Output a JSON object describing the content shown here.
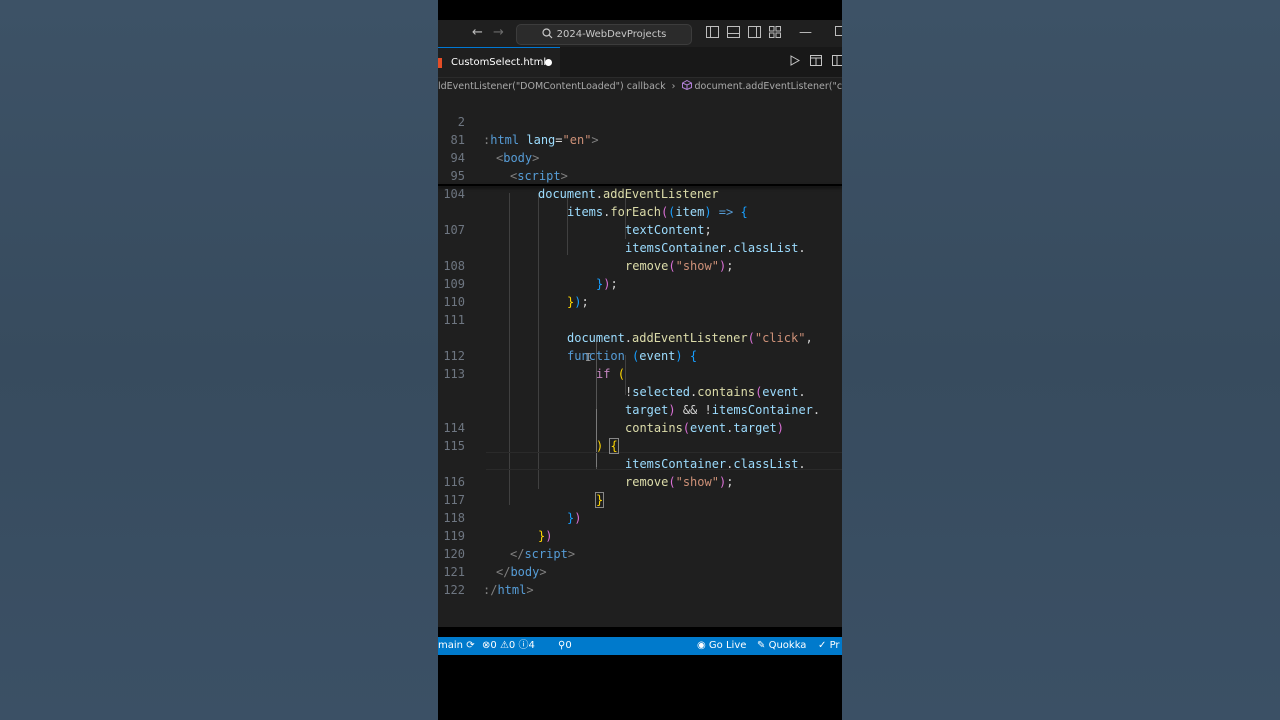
{
  "window": {
    "search_text": "2024-WebDevProjects"
  },
  "tab": {
    "filename": "CustomSelect.html"
  },
  "breadcrumb": {
    "part1": "ldEventListener(\"DOMContentLoaded\") callback",
    "separator": "›",
    "part2": "document.addEventListener(\"click"
  },
  "editor": {
    "line_numbers": [
      "2",
      "81",
      "94",
      "95",
      "104",
      "",
      "107",
      "",
      "108",
      "109",
      "110",
      "111",
      "",
      "112",
      "113",
      "",
      "",
      "114",
      "115",
      "",
      "116",
      "117",
      "118",
      "119",
      "120",
      "121",
      "122"
    ]
  },
  "status": {
    "branch": "main",
    "errors": "0",
    "warnings": "0",
    "info": "4",
    "ports": "0",
    "go_live": "Go Live",
    "quokka": "Quokka",
    "prettier": "Pr"
  }
}
